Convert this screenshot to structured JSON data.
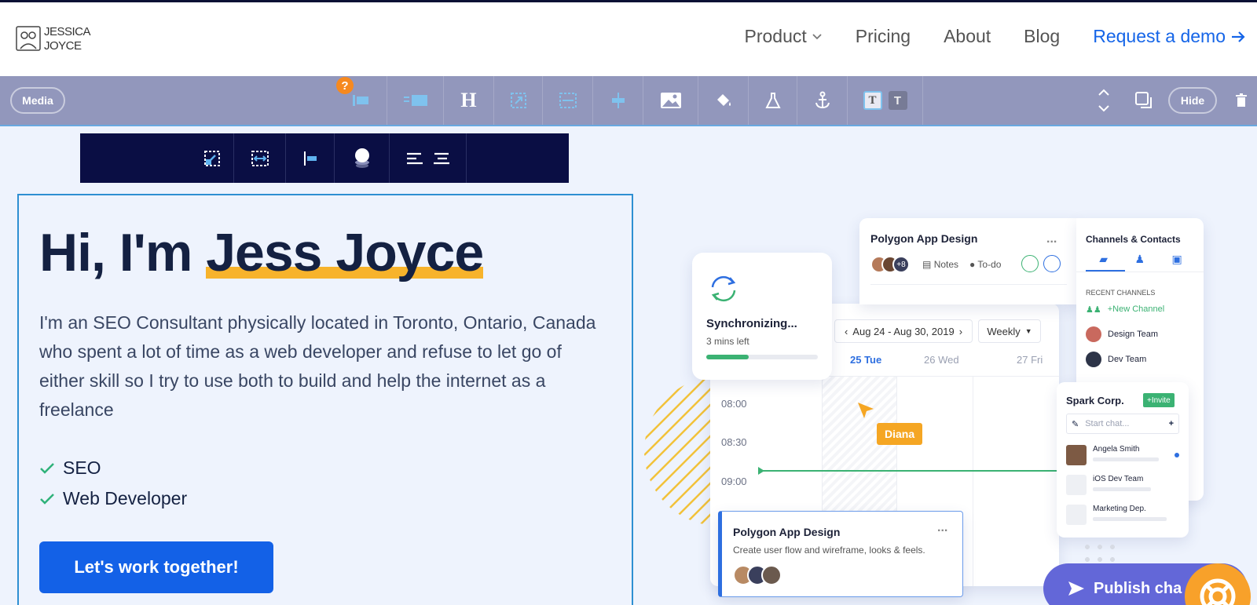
{
  "brand": {
    "line1": "JESSICA",
    "line2": "JOYCE"
  },
  "nav": {
    "product": "Product",
    "pricing": "Pricing",
    "about": "About",
    "blog": "Blog",
    "demo": "Request a demo"
  },
  "toolbar": {
    "media_label": "Media",
    "hide_label": "Hide",
    "help_label": "?",
    "heading_glyph": "H",
    "text_glyph_1": "T",
    "text_glyph_2": "T"
  },
  "hero": {
    "title_prefix": "Hi, I'm ",
    "title_name": "Jess Joyce",
    "body": "I'm an SEO Consultant physically located in Toronto, Ontario, Canada who spent a lot of time as a web developer and refuse to let go of either skill so I try to use both to build and help the internet as a freelance",
    "checks": [
      "SEO",
      "Web Developer"
    ],
    "cta": "Let's work together!"
  },
  "mockup": {
    "project_card": {
      "title": "Polygon App Design",
      "more": "...",
      "avatar_extra": "+8",
      "notes": "Notes",
      "todo": "To-do"
    },
    "sync_card": {
      "title": "Synchronizing...",
      "subtitle": "3 mins left",
      "progress": 0.38
    },
    "calendar": {
      "range": "Aug 24 - Aug 30, 2019",
      "view": "Weekly",
      "days": [
        "25 Tue",
        "26 Wed",
        "27 Fri"
      ],
      "times": [
        "08:00",
        "08:30",
        "09:00"
      ],
      "cursor_label": "Diana"
    },
    "channels": {
      "title": "Channels & Contacts",
      "section": "RECENT CHANNELS",
      "new_channel": "+New Channel",
      "items": [
        "Design Team",
        "Dev Team"
      ]
    },
    "spark": {
      "title": "Spark Corp.",
      "invite": "+Invite",
      "placeholder": "Start chat...",
      "add": "+",
      "contacts": [
        "Angela Smith",
        "iOS Dev Team",
        "Marketing Dep."
      ]
    },
    "task_card": {
      "title": "Polygon App Design",
      "more": "...",
      "desc": "Create user flow and wireframe, looks & feels."
    }
  },
  "publish": {
    "label": "Publish cha"
  },
  "colors": {
    "accent": "#1361e7",
    "toolbar": "#9297bc",
    "highlight": "#f7b32b",
    "subbar": "#0a0e44",
    "green": "#3bb273"
  }
}
